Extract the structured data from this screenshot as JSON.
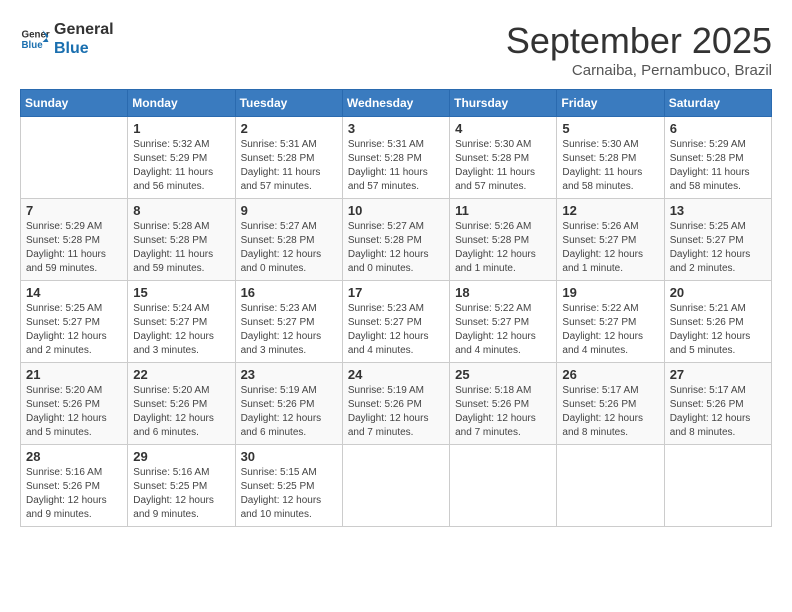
{
  "logo": {
    "text_general": "General",
    "text_blue": "Blue"
  },
  "title": "September 2025",
  "location": "Carnaiba, Pernambuco, Brazil",
  "headers": [
    "Sunday",
    "Monday",
    "Tuesday",
    "Wednesday",
    "Thursday",
    "Friday",
    "Saturday"
  ],
  "weeks": [
    [
      {
        "day": "",
        "info": ""
      },
      {
        "day": "1",
        "info": "Sunrise: 5:32 AM\nSunset: 5:29 PM\nDaylight: 11 hours\nand 56 minutes."
      },
      {
        "day": "2",
        "info": "Sunrise: 5:31 AM\nSunset: 5:28 PM\nDaylight: 11 hours\nand 57 minutes."
      },
      {
        "day": "3",
        "info": "Sunrise: 5:31 AM\nSunset: 5:28 PM\nDaylight: 11 hours\nand 57 minutes."
      },
      {
        "day": "4",
        "info": "Sunrise: 5:30 AM\nSunset: 5:28 PM\nDaylight: 11 hours\nand 57 minutes."
      },
      {
        "day": "5",
        "info": "Sunrise: 5:30 AM\nSunset: 5:28 PM\nDaylight: 11 hours\nand 58 minutes."
      },
      {
        "day": "6",
        "info": "Sunrise: 5:29 AM\nSunset: 5:28 PM\nDaylight: 11 hours\nand 58 minutes."
      }
    ],
    [
      {
        "day": "7",
        "info": "Sunrise: 5:29 AM\nSunset: 5:28 PM\nDaylight: 11 hours\nand 59 minutes."
      },
      {
        "day": "8",
        "info": "Sunrise: 5:28 AM\nSunset: 5:28 PM\nDaylight: 11 hours\nand 59 minutes."
      },
      {
        "day": "9",
        "info": "Sunrise: 5:27 AM\nSunset: 5:28 PM\nDaylight: 12 hours\nand 0 minutes."
      },
      {
        "day": "10",
        "info": "Sunrise: 5:27 AM\nSunset: 5:28 PM\nDaylight: 12 hours\nand 0 minutes."
      },
      {
        "day": "11",
        "info": "Sunrise: 5:26 AM\nSunset: 5:28 PM\nDaylight: 12 hours\nand 1 minute."
      },
      {
        "day": "12",
        "info": "Sunrise: 5:26 AM\nSunset: 5:27 PM\nDaylight: 12 hours\nand 1 minute."
      },
      {
        "day": "13",
        "info": "Sunrise: 5:25 AM\nSunset: 5:27 PM\nDaylight: 12 hours\nand 2 minutes."
      }
    ],
    [
      {
        "day": "14",
        "info": "Sunrise: 5:25 AM\nSunset: 5:27 PM\nDaylight: 12 hours\nand 2 minutes."
      },
      {
        "day": "15",
        "info": "Sunrise: 5:24 AM\nSunset: 5:27 PM\nDaylight: 12 hours\nand 3 minutes."
      },
      {
        "day": "16",
        "info": "Sunrise: 5:23 AM\nSunset: 5:27 PM\nDaylight: 12 hours\nand 3 minutes."
      },
      {
        "day": "17",
        "info": "Sunrise: 5:23 AM\nSunset: 5:27 PM\nDaylight: 12 hours\nand 4 minutes."
      },
      {
        "day": "18",
        "info": "Sunrise: 5:22 AM\nSunset: 5:27 PM\nDaylight: 12 hours\nand 4 minutes."
      },
      {
        "day": "19",
        "info": "Sunrise: 5:22 AM\nSunset: 5:27 PM\nDaylight: 12 hours\nand 4 minutes."
      },
      {
        "day": "20",
        "info": "Sunrise: 5:21 AM\nSunset: 5:26 PM\nDaylight: 12 hours\nand 5 minutes."
      }
    ],
    [
      {
        "day": "21",
        "info": "Sunrise: 5:20 AM\nSunset: 5:26 PM\nDaylight: 12 hours\nand 5 minutes."
      },
      {
        "day": "22",
        "info": "Sunrise: 5:20 AM\nSunset: 5:26 PM\nDaylight: 12 hours\nand 6 minutes."
      },
      {
        "day": "23",
        "info": "Sunrise: 5:19 AM\nSunset: 5:26 PM\nDaylight: 12 hours\nand 6 minutes."
      },
      {
        "day": "24",
        "info": "Sunrise: 5:19 AM\nSunset: 5:26 PM\nDaylight: 12 hours\nand 7 minutes."
      },
      {
        "day": "25",
        "info": "Sunrise: 5:18 AM\nSunset: 5:26 PM\nDaylight: 12 hours\nand 7 minutes."
      },
      {
        "day": "26",
        "info": "Sunrise: 5:17 AM\nSunset: 5:26 PM\nDaylight: 12 hours\nand 8 minutes."
      },
      {
        "day": "27",
        "info": "Sunrise: 5:17 AM\nSunset: 5:26 PM\nDaylight: 12 hours\nand 8 minutes."
      }
    ],
    [
      {
        "day": "28",
        "info": "Sunrise: 5:16 AM\nSunset: 5:26 PM\nDaylight: 12 hours\nand 9 minutes."
      },
      {
        "day": "29",
        "info": "Sunrise: 5:16 AM\nSunset: 5:25 PM\nDaylight: 12 hours\nand 9 minutes."
      },
      {
        "day": "30",
        "info": "Sunrise: 5:15 AM\nSunset: 5:25 PM\nDaylight: 12 hours\nand 10 minutes."
      },
      {
        "day": "",
        "info": ""
      },
      {
        "day": "",
        "info": ""
      },
      {
        "day": "",
        "info": ""
      },
      {
        "day": "",
        "info": ""
      }
    ]
  ]
}
